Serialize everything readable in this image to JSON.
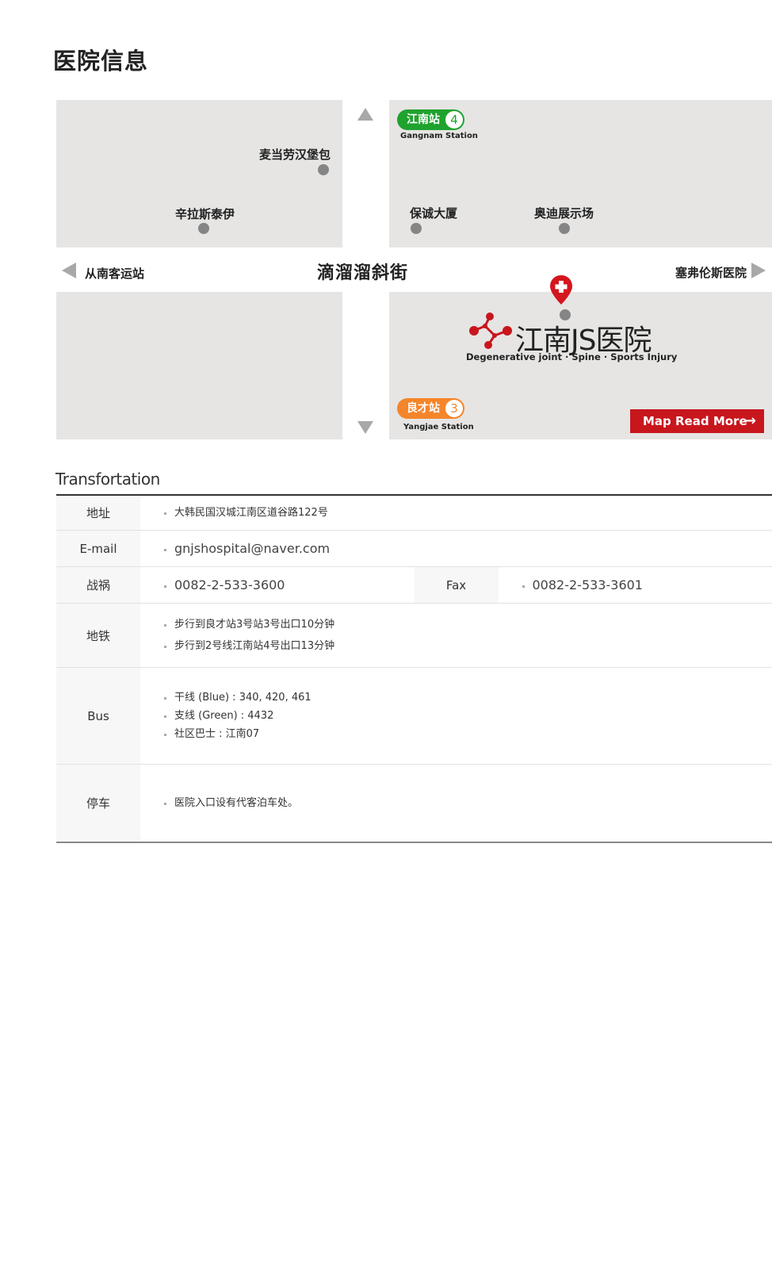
{
  "page": {
    "title": "医院信息"
  },
  "map": {
    "poi": {
      "mcdonalds": "麦当劳汉堡包",
      "shinsegae": "辛拉斯泰伊",
      "samsung": "保诚大厦",
      "audi": "奥迪展示场"
    },
    "street": "滴溜溜斜街",
    "left_road": "从南客运站",
    "right_road": "塞弗伦斯医院",
    "station_top": {
      "name": "江南站",
      "line": "4",
      "sub": "Gangnam Station",
      "color": "#1fa22e"
    },
    "station_bottom": {
      "name": "良才站",
      "line": "3",
      "sub": "Yangjae Station",
      "color": "#f5852a"
    },
    "logo": {
      "name": "江南JS医院",
      "tagline": "Degenerative joint · Spine · Sports Injury",
      "color": "#c8161d"
    },
    "more_button": "Map Read More"
  },
  "transport": {
    "title": "Transfortation",
    "address_label": "地址",
    "address": "大韩民国汉城江南区道谷路122号",
    "email_label": "E-mail",
    "email": "gnjshospital@naver.com",
    "phone_label": "战祸",
    "phone": "0082-2-533-3600",
    "fax_label": "Fax",
    "fax": "0082-2-533-3601",
    "subway_label": "地铁",
    "subway": [
      "步行到良才站3号站3号出口10分钟",
      "步行到2号线江南站4号出口13分钟"
    ],
    "bus_label": "Bus",
    "bus": [
      "干线 (Blue) : 340, 420, 461",
      "支线 (Green) : 4432",
      "社区巴士 : 江南07"
    ],
    "parking_label": "停车",
    "parking": "医院入口设有代客泊车处。"
  }
}
